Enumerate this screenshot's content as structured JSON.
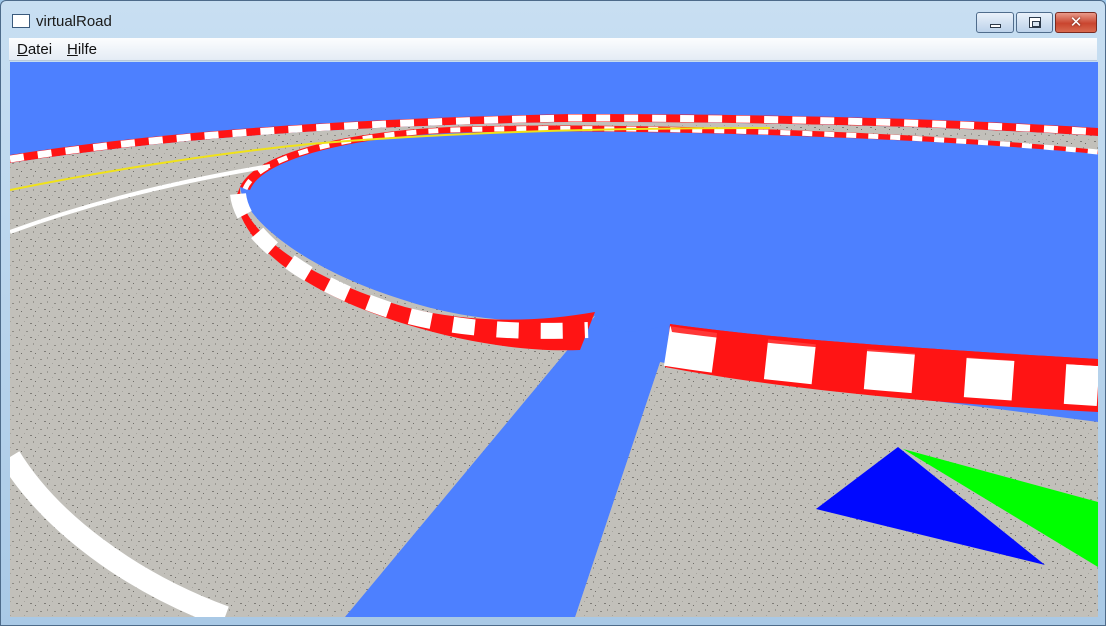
{
  "window": {
    "title": "virtualRoad",
    "icon": "app-window-icon",
    "controls": {
      "minimize": "minimize-icon",
      "maximize": "maximize-icon",
      "close": "close-icon",
      "close_glyph": "✕"
    }
  },
  "menu": {
    "items": [
      {
        "mnemonic": "D",
        "rest": "atei"
      },
      {
        "mnemonic": "H",
        "rest": "ilfe"
      }
    ]
  },
  "scene": {
    "sky_color": "#4d80ff",
    "ground_color": "#c2c0ba",
    "curb_colors": [
      "#ff1414",
      "#ffffff"
    ],
    "lane_colors": [
      "#ffffff",
      "#f0e21a"
    ],
    "markers": [
      {
        "name": "blue-direction-marker",
        "color": "#0008ff"
      },
      {
        "name": "green-direction-marker",
        "color": "#00ff00"
      }
    ]
  }
}
